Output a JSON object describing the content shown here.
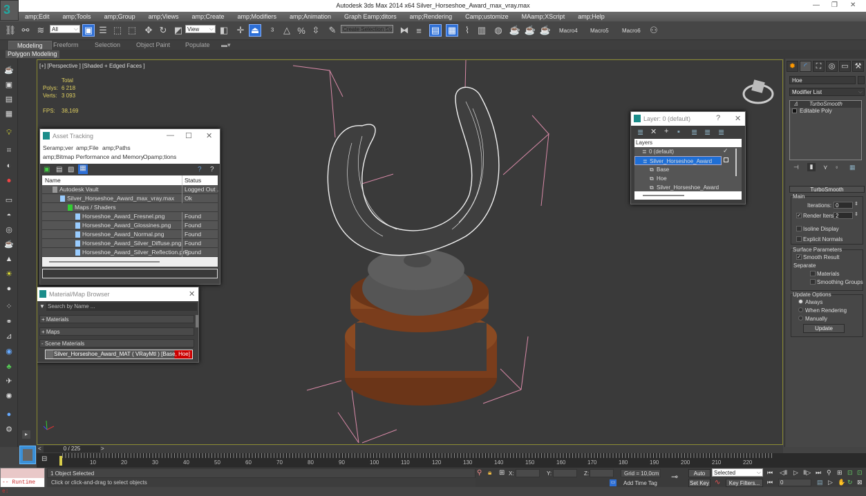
{
  "window": {
    "title": "Autodesk 3ds Max  2014 x64     Silver_Horseshoe_Award_max_vray.max",
    "controls": [
      "—",
      "❐",
      "✕"
    ]
  },
  "menu": [
    "amp;Edit",
    "amp;Tools",
    "amp;Group",
    "amp;Views",
    "amp;Create",
    "amp;Modifiers",
    "amp;Animation",
    "Graph Eamp;ditors",
    "amp;Rendering",
    "Camp;ustomize",
    "MAamp;XScript",
    "amp;Help"
  ],
  "toolbar": {
    "selection_filter": "All",
    "ref_coord": "View",
    "named_selection": "Create Selection Se",
    "macros": [
      "Macro4",
      "Macro5",
      "Macro6"
    ]
  },
  "ribbon": {
    "tabs": [
      "Modeling",
      "Freeform",
      "Selection",
      "Object Paint",
      "Populate"
    ],
    "active_tab": "Modeling",
    "panel": "Polygon Modeling"
  },
  "viewport": {
    "label": "[+] [Perspective ] [Shaded + Edged Faces ]",
    "stats": {
      "header": "Total",
      "polys_label": "Polys:",
      "polys": "6 218",
      "verts_label": "Verts:",
      "verts": "3 093",
      "fps_label": "FPS:",
      "fps": "38,169"
    }
  },
  "asset_tracking": {
    "title": "Asset Tracking",
    "menu1": [
      "Seramp;ver",
      "amp;File",
      "amp;Paths"
    ],
    "menu2": [
      "amp;Bitmap Performance and Memory",
      "Opamp;tions"
    ],
    "columns": [
      "Name",
      "Status"
    ],
    "rows": [
      {
        "name": "Autodesk Vault",
        "status": "Logged Out ...",
        "indent": 1,
        "icon": "vault-icon"
      },
      {
        "name": "Silver_Horseshoe_Award_max_vray.max",
        "status": "Ok",
        "indent": 2,
        "icon": "max-file-icon"
      },
      {
        "name": "Maps / Shaders",
        "status": "",
        "indent": 3,
        "icon": "maps-folder-icon"
      },
      {
        "name": "Horseshoe_Award_Fresnel.png",
        "status": "Found",
        "indent": 4,
        "icon": "image-file-icon"
      },
      {
        "name": "Horseshoe_Award_Glossines.png",
        "status": "Found",
        "indent": 4,
        "icon": "image-file-icon"
      },
      {
        "name": "Horseshoe_Award_Normal.png",
        "status": "Found",
        "indent": 4,
        "icon": "image-file-icon"
      },
      {
        "name": "Horseshoe_Award_Silver_Diffuse.png",
        "status": "Found",
        "indent": 4,
        "icon": "image-file-icon"
      },
      {
        "name": "Horseshoe_Award_Silver_Reflection.png",
        "status": "Found",
        "indent": 4,
        "icon": "image-file-icon"
      }
    ]
  },
  "material_browser": {
    "title": "Material/Map Browser",
    "search_placeholder": "Search by Name ...",
    "groups": [
      "+ Materials",
      "+ Maps",
      "- Scene Materials"
    ],
    "scene_material": "Silver_Horseshoe_Award_MAT  ( VRayMtl ) [Base, Hoe]"
  },
  "layer_dialog": {
    "title": "Layer: 0 (default)",
    "help": "?",
    "header": "Layers",
    "items": [
      {
        "name": "0 (default)",
        "indent": 1,
        "icon": "layer-icon"
      },
      {
        "name": "Silver_Horseshoe_Award",
        "indent": 1,
        "icon": "layer-icon",
        "selected": true
      },
      {
        "name": "Base",
        "indent": 2,
        "icon": "object-icon"
      },
      {
        "name": "Hoe",
        "indent": 2,
        "icon": "object-icon"
      },
      {
        "name": "Silver_Horseshoe_Award",
        "indent": 2,
        "icon": "object-icon"
      }
    ]
  },
  "command_panel": {
    "object_name": "Hoe",
    "modifier_list": "Modifier List",
    "stack": [
      "TurboSmooth",
      "Editable Poly"
    ],
    "turbosmooth": {
      "title": "TurboSmooth",
      "main": "Main",
      "iterations_label": "Iterations:",
      "iterations": "0",
      "render_iters_label": "Render Iters:",
      "render_iters": "2",
      "render_iters_checked": true,
      "isoline": "Isoline Display",
      "explicit_normals": "Explicit Normals",
      "surface_params": "Surface Parameters",
      "smooth_result": "Smooth Result",
      "separate": "Separate",
      "materials": "Materials",
      "smoothing_groups": "Smoothing Groups",
      "update_options": "Update Options",
      "always": "Always",
      "when_rendering": "When Rendering",
      "manually": "Manually",
      "update_button": "Update"
    }
  },
  "timeline": {
    "frame": "0 / 225",
    "prev": "<",
    "next": ">",
    "ticks": [
      "10",
      "20",
      "30",
      "40",
      "50",
      "60",
      "70",
      "80",
      "90",
      "100",
      "110",
      "120",
      "130",
      "140",
      "150",
      "160",
      "170",
      "180",
      "190",
      "200",
      "210",
      "220"
    ]
  },
  "status": {
    "maxscript": "-- Runtime e:",
    "selected": "1 Object Selected",
    "prompt": "Click or click-and-drag to select objects",
    "x_label": "X:",
    "y_label": "Y:",
    "z_label": "Z:",
    "grid": "Grid = 10,0cm",
    "add_time_tag": "Add Time Tag",
    "auto_key": "Auto Key",
    "set_key": "Set Key",
    "key_mode": "Selected",
    "key_filters": "Key Filters...",
    "current_frame": "0"
  }
}
